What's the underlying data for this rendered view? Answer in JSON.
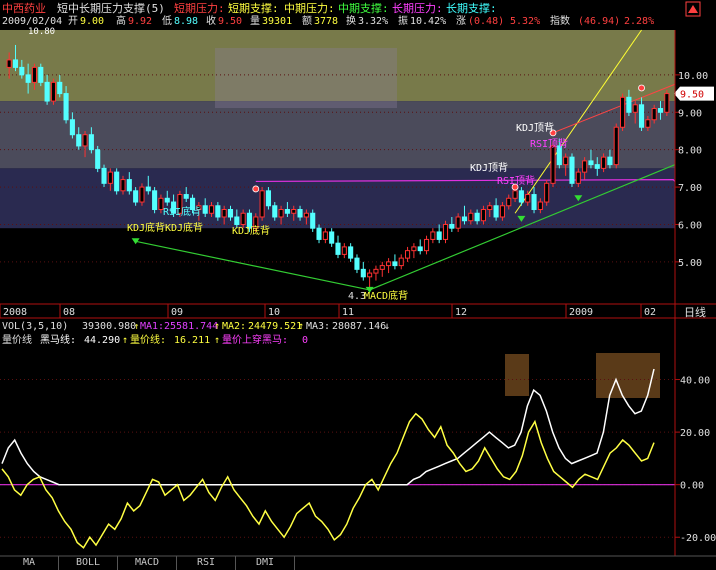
{
  "header": {
    "stock_name": "中西药业",
    "indicator": "短中长期压力支撑(5)",
    "legend_short_press": "短期压力:",
    "legend_short_support": "短期支撑:",
    "legend_mid_press": "中期压力:",
    "legend_mid_support": "中期支撑:",
    "legend_long_press": "长期压力:",
    "legend_long_support": "长期支撑:",
    "date": "2009/02/04",
    "open_label": "开",
    "open": "9.00",
    "high_label": "高",
    "high": "9.92",
    "low_label": "低",
    "low": "8.98",
    "close_label": "收",
    "close": "9.50",
    "vol_label": "量",
    "vol": "39301",
    "amt_label": "额",
    "amt": "3778",
    "turn_label": "换",
    "turn": "3.32%",
    "amp_label": "振",
    "amp": "10.42%",
    "chg_label": "涨",
    "chg": "(0.48)",
    "chg_pct": "5.32%",
    "index_label": "指数",
    "index_val": "(46.94)",
    "index_pct": "2.28%"
  },
  "price_axis": [
    "10.00",
    "9.00",
    "8.00",
    "7.00",
    "6.00",
    "5.00"
  ],
  "price_tag": "9.50",
  "peak_label": "10.80",
  "time_axis": [
    "2008",
    "08",
    "09",
    "10",
    "11",
    "12",
    "2009",
    "02"
  ],
  "time_axis_right": "日线",
  "annotations": {
    "kdj_bottom1": "KDJ底背",
    "kdj_bottom2": "KDJ底背",
    "rsi_bottom": "RSI底背",
    "kdj_bottom3": "KDJ底背",
    "low_price": "4.3",
    "macd_bottom": "MACD底背",
    "kdj_top1": "KDJ顶背",
    "rsi_top1": "RSI顶背",
    "kdj_top2": "KDJ顶背",
    "rsi_top2": "RSI顶背"
  },
  "vol_line": {
    "label": "VOL(3,5,10)",
    "value": "39300.980",
    "ma1_label": "MA1:",
    "ma1": "25581.744",
    "ma2_label": "MA2:",
    "ma2": "24479.521",
    "ma3_label": "MA3:",
    "ma3": "28087.146"
  },
  "indicator_line": {
    "name": "量价线",
    "black_horse_label": "黑马线:",
    "black_horse": "44.290",
    "vp_label": "量价线:",
    "vp": "16.211",
    "cross_label": "量价上穿黑马:",
    "cross": "0"
  },
  "indicator_axis": [
    "40.00",
    "20.00",
    "0.00",
    "-20.00"
  ],
  "tabs": [
    "MA",
    "BOLL",
    "MACD",
    "RSI",
    "DMI"
  ],
  "colors": {
    "up_candle": "#ff3232",
    "down_candle": "#54ffff",
    "bg": "#000000",
    "band_upper": "#787a4a",
    "band_mid": "#4b4b5b",
    "band_lower": "#2a2a50",
    "trend_green": "#33cc33",
    "trend_yellow": "#ffff33",
    "trend_red": "#ff4444",
    "magenta_line": "#e030e0",
    "vp_line": "#ffff44",
    "horse_line": "#ffffff"
  },
  "chart_data": {
    "type": "candlestick",
    "period": "daily",
    "ylim": [
      3.9,
      11.2
    ],
    "last_close": 9.5,
    "ohlc": [
      [
        10.2,
        10.6,
        9.9,
        10.4
      ],
      [
        10.4,
        10.8,
        10.1,
        10.2
      ],
      [
        10.2,
        10.4,
        9.9,
        10.0
      ],
      [
        10.0,
        10.3,
        9.5,
        9.8
      ],
      [
        9.8,
        10.3,
        9.6,
        10.2
      ],
      [
        10.2,
        10.3,
        9.7,
        9.8
      ],
      [
        9.8,
        10.0,
        9.2,
        9.3
      ],
      [
        9.3,
        9.9,
        9.2,
        9.8
      ],
      [
        9.8,
        10.0,
        9.4,
        9.5
      ],
      [
        9.5,
        9.7,
        8.7,
        8.8
      ],
      [
        8.8,
        9.0,
        8.3,
        8.4
      ],
      [
        8.4,
        8.6,
        8.0,
        8.1
      ],
      [
        8.1,
        8.5,
        7.8,
        8.4
      ],
      [
        8.4,
        8.6,
        7.9,
        8.0
      ],
      [
        8.0,
        8.1,
        7.4,
        7.5
      ],
      [
        7.5,
        7.6,
        7.0,
        7.1
      ],
      [
        7.1,
        7.5,
        6.9,
        7.4
      ],
      [
        7.4,
        7.5,
        6.8,
        6.9
      ],
      [
        6.9,
        7.3,
        6.8,
        7.2
      ],
      [
        7.2,
        7.4,
        6.8,
        6.9
      ],
      [
        6.9,
        7.0,
        6.5,
        6.6
      ],
      [
        6.6,
        7.1,
        6.5,
        7.0
      ],
      [
        7.0,
        7.3,
        6.8,
        6.9
      ],
      [
        6.9,
        7.0,
        6.3,
        6.4
      ],
      [
        6.4,
        6.8,
        6.3,
        6.7
      ],
      [
        6.7,
        6.9,
        6.5,
        6.6
      ],
      [
        6.6,
        6.8,
        6.2,
        6.3
      ],
      [
        6.3,
        6.9,
        6.2,
        6.8
      ],
      [
        6.8,
        7.0,
        6.6,
        6.7
      ],
      [
        6.7,
        6.8,
        6.3,
        6.4
      ],
      [
        6.4,
        6.6,
        6.1,
        6.5
      ],
      [
        6.5,
        6.7,
        6.2,
        6.3
      ],
      [
        6.3,
        6.6,
        6.2,
        6.5
      ],
      [
        6.5,
        6.6,
        6.1,
        6.2
      ],
      [
        6.2,
        6.5,
        6.0,
        6.4
      ],
      [
        6.4,
        6.5,
        6.1,
        6.2
      ],
      [
        6.2,
        6.4,
        5.9,
        6.0
      ],
      [
        6.0,
        6.4,
        5.9,
        6.3
      ],
      [
        6.3,
        6.4,
        5.8,
        5.9
      ],
      [
        5.9,
        6.3,
        5.8,
        6.2
      ],
      [
        6.2,
        7.0,
        6.1,
        6.9
      ],
      [
        6.9,
        7.0,
        6.4,
        6.5
      ],
      [
        6.5,
        6.6,
        6.1,
        6.2
      ],
      [
        6.2,
        6.5,
        6.0,
        6.4
      ],
      [
        6.4,
        6.6,
        6.2,
        6.3
      ],
      [
        6.3,
        6.5,
        6.1,
        6.4
      ],
      [
        6.4,
        6.5,
        6.1,
        6.2
      ],
      [
        6.2,
        6.4,
        6.0,
        6.3
      ],
      [
        6.3,
        6.4,
        5.8,
        5.9
      ],
      [
        5.9,
        6.0,
        5.5,
        5.6
      ],
      [
        5.6,
        5.9,
        5.5,
        5.8
      ],
      [
        5.8,
        5.9,
        5.4,
        5.5
      ],
      [
        5.5,
        5.7,
        5.1,
        5.2
      ],
      [
        5.2,
        5.5,
        5.1,
        5.4
      ],
      [
        5.4,
        5.5,
        5.0,
        5.1
      ],
      [
        5.1,
        5.2,
        4.7,
        4.8
      ],
      [
        4.8,
        5.0,
        4.5,
        4.6
      ],
      [
        4.6,
        4.8,
        4.3,
        4.7
      ],
      [
        4.7,
        4.9,
        4.5,
        4.8
      ],
      [
        4.8,
        5.0,
        4.6,
        4.9
      ],
      [
        4.9,
        5.1,
        4.7,
        5.0
      ],
      [
        5.0,
        5.2,
        4.8,
        4.9
      ],
      [
        4.9,
        5.2,
        4.8,
        5.1
      ],
      [
        5.1,
        5.4,
        5.0,
        5.3
      ],
      [
        5.3,
        5.5,
        5.1,
        5.4
      ],
      [
        5.4,
        5.6,
        5.2,
        5.3
      ],
      [
        5.3,
        5.7,
        5.2,
        5.6
      ],
      [
        5.6,
        5.9,
        5.5,
        5.8
      ],
      [
        5.8,
        6.0,
        5.5,
        5.6
      ],
      [
        5.6,
        6.1,
        5.5,
        6.0
      ],
      [
        6.0,
        6.2,
        5.8,
        5.9
      ],
      [
        5.9,
        6.3,
        5.8,
        6.2
      ],
      [
        6.2,
        6.5,
        6.0,
        6.1
      ],
      [
        6.1,
        6.4,
        6.0,
        6.3
      ],
      [
        6.3,
        6.4,
        6.0,
        6.1
      ],
      [
        6.1,
        6.5,
        6.0,
        6.4
      ],
      [
        6.4,
        6.6,
        6.2,
        6.5
      ],
      [
        6.5,
        6.7,
        6.1,
        6.2
      ],
      [
        6.2,
        6.6,
        6.1,
        6.5
      ],
      [
        6.5,
        6.8,
        6.4,
        6.7
      ],
      [
        6.7,
        7.0,
        6.6,
        6.9
      ],
      [
        6.9,
        7.0,
        6.5,
        6.6
      ],
      [
        6.6,
        6.9,
        6.5,
        6.8
      ],
      [
        6.8,
        7.0,
        6.3,
        6.4
      ],
      [
        6.4,
        6.7,
        6.3,
        6.6
      ],
      [
        6.6,
        7.2,
        6.5,
        7.1
      ],
      [
        7.1,
        8.2,
        7.0,
        8.1
      ],
      [
        8.1,
        8.3,
        7.5,
        7.6
      ],
      [
        7.6,
        7.9,
        7.3,
        7.8
      ],
      [
        7.8,
        7.9,
        7.0,
        7.1
      ],
      [
        7.1,
        7.5,
        7.0,
        7.4
      ],
      [
        7.4,
        7.8,
        7.2,
        7.7
      ],
      [
        7.7,
        8.0,
        7.5,
        7.6
      ],
      [
        7.6,
        7.8,
        7.3,
        7.5
      ],
      [
        7.5,
        7.9,
        7.4,
        7.8
      ],
      [
        7.8,
        8.0,
        7.5,
        7.6
      ],
      [
        7.6,
        8.7,
        7.5,
        8.6
      ],
      [
        8.6,
        9.5,
        8.5,
        9.4
      ],
      [
        9.4,
        9.6,
        8.9,
        9.0
      ],
      [
        9.0,
        9.3,
        8.7,
        9.2
      ],
      [
        9.2,
        9.4,
        8.5,
        8.6
      ],
      [
        8.6,
        8.9,
        8.5,
        8.8
      ],
      [
        8.8,
        9.2,
        8.7,
        9.1
      ],
      [
        9.1,
        9.3,
        8.8,
        9.0
      ],
      [
        9.0,
        9.6,
        8.9,
        9.5
      ]
    ],
    "volume_price_line": [
      6,
      3,
      -2,
      -4,
      0,
      2,
      3,
      -2,
      -5,
      -10,
      -14,
      -17,
      -22,
      -24,
      -20,
      -23,
      -19,
      -15,
      -17,
      -13,
      -7,
      -10,
      -8,
      -3,
      2,
      1,
      -4,
      -2,
      0,
      -6,
      -4,
      -1,
      2,
      -3,
      -6,
      -1,
      3,
      -2,
      -5,
      -8,
      -12,
      -15,
      -10,
      -14,
      -17,
      -20,
      -16,
      -11,
      -9,
      -7,
      -12,
      -14,
      -17,
      -21,
      -19,
      -15,
      -9,
      -5,
      0,
      2,
      -2,
      3,
      8,
      12,
      18,
      24,
      27,
      25,
      21,
      18,
      22,
      15,
      12,
      8,
      5,
      6,
      9,
      14,
      10,
      6,
      3,
      2,
      5,
      11,
      20,
      24,
      16,
      10,
      5,
      3,
      1,
      -1,
      2,
      4,
      3,
      2,
      7,
      12,
      14,
      17,
      15,
      12,
      9,
      10,
      16
    ],
    "black_horse_line": [
      8,
      14,
      17,
      12,
      8,
      5,
      3,
      2,
      1,
      0,
      0,
      0,
      0,
      0,
      0,
      0,
      0,
      0,
      0,
      0,
      0,
      0,
      0,
      0,
      0,
      0,
      0,
      0,
      0,
      0,
      0,
      0,
      0,
      0,
      0,
      0,
      0,
      0,
      0,
      0,
      0,
      0,
      0,
      0,
      0,
      0,
      0,
      0,
      0,
      0,
      0,
      0,
      0,
      0,
      0,
      0,
      0,
      0,
      0,
      0,
      0,
      0,
      0,
      0,
      0,
      2,
      3,
      5,
      6,
      7,
      8,
      9,
      10,
      12,
      14,
      16,
      18,
      20,
      18,
      16,
      14,
      15,
      20,
      30,
      36,
      34,
      28,
      20,
      14,
      10,
      8,
      9,
      10,
      11,
      12,
      20,
      34,
      40,
      34,
      30,
      27,
      28,
      34,
      44
    ],
    "zero_line": 0,
    "indicator_ylim": [
      -26,
      52
    ]
  }
}
